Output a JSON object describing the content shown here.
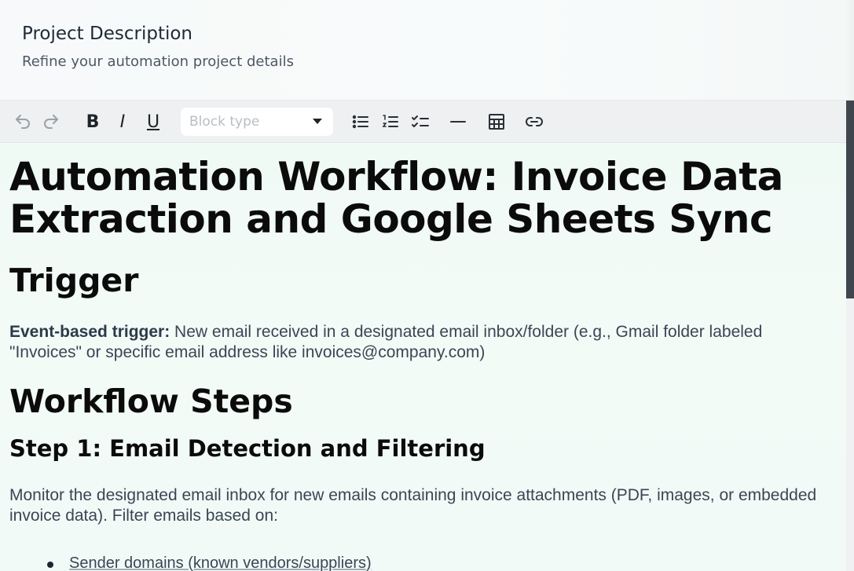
{
  "header": {
    "title": "Project Description",
    "subtitle": "Refine your automation project details"
  },
  "toolbar": {
    "undo_icon": "undo-icon",
    "redo_icon": "redo-icon",
    "bold_label": "B",
    "italic_label": "I",
    "underline_label": "U",
    "block_type_placeholder": "Block type",
    "icons": [
      "bullet-list-icon",
      "numbered-list-icon",
      "checklist-icon",
      "horizontal-rule-icon",
      "table-icon",
      "link-icon"
    ]
  },
  "document": {
    "title": "Automation Workflow: Invoice Data Extraction and Google Sheets Sync",
    "section_trigger": "Trigger",
    "trigger_label": "Event-based trigger:",
    "trigger_text": " New email received in a designated email inbox/folder (e.g., Gmail folder labeled \"Invoices\" or specific email address like invoices@company.com)",
    "section_steps": "Workflow Steps",
    "step1_title": "Step 1: Email Detection and Filtering",
    "step1_text": "Monitor the designated email inbox for new emails containing invoice attachments (PDF, images, or embedded invoice data). Filter emails based on:",
    "step1_items": [
      "Sender domains (known vendors/suppliers)"
    ]
  }
}
